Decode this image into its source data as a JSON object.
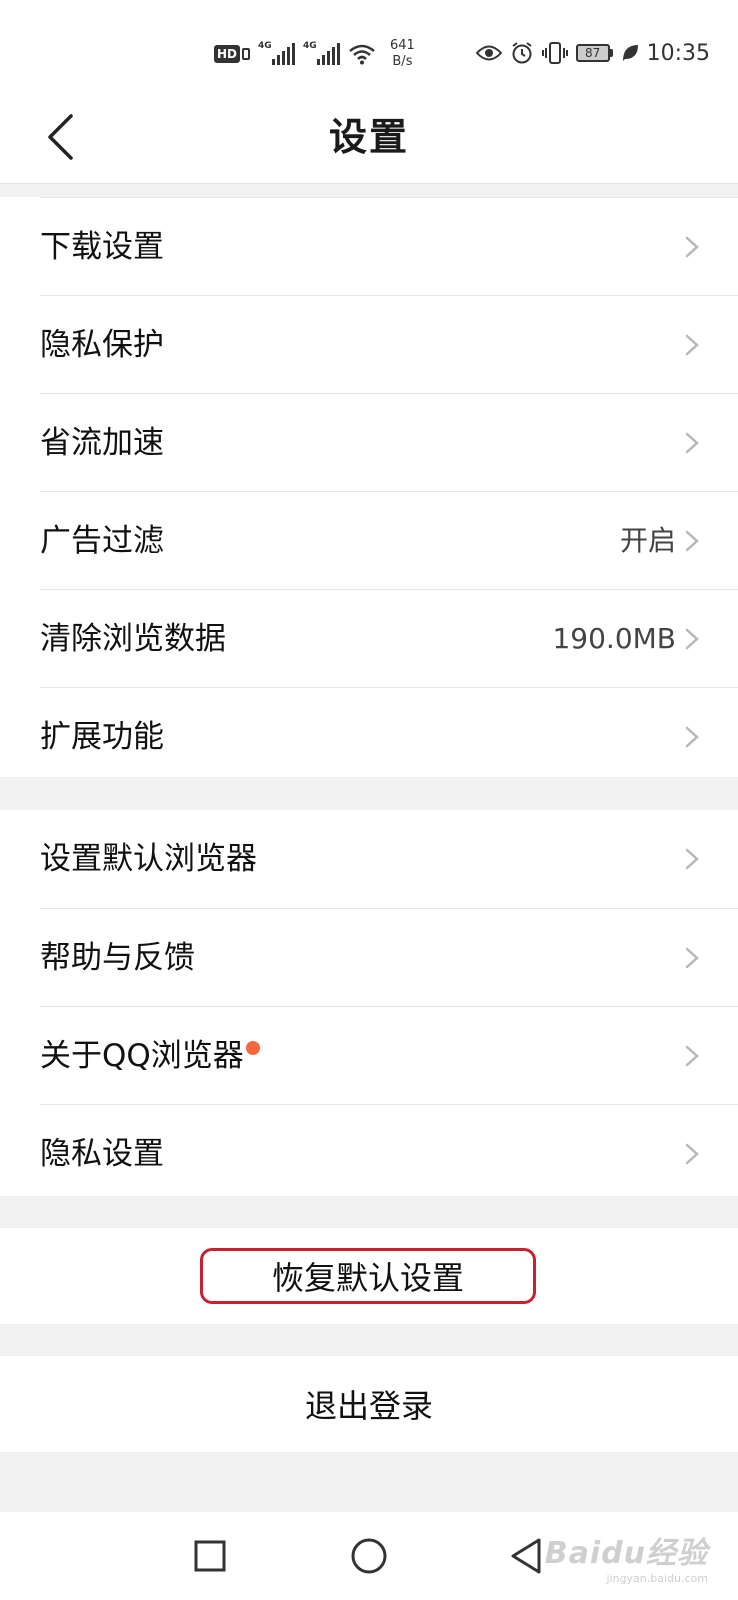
{
  "status_bar": {
    "hd_label": "HD",
    "network_1": "4G",
    "network_2": "4G",
    "speed_value": "641",
    "speed_unit": "B/s",
    "battery": "87",
    "time": "10:35"
  },
  "header": {
    "title": "设置"
  },
  "group1": {
    "items": [
      {
        "label": "下载设置"
      },
      {
        "label": "隐私保护"
      },
      {
        "label": "省流加速"
      },
      {
        "label": "广告过滤",
        "value": "开启"
      },
      {
        "label": "清除浏览数据",
        "value": "190.0MB"
      },
      {
        "label": "扩展功能"
      }
    ]
  },
  "group2": {
    "items": [
      {
        "label": "设置默认浏览器"
      },
      {
        "label": "帮助与反馈"
      },
      {
        "label": "关于QQ浏览器"
      },
      {
        "label": "隐私设置"
      }
    ]
  },
  "actions": {
    "restore_label": "恢复默认设置",
    "logout_label": "退出登录"
  },
  "watermark": {
    "main": "Baidu经验",
    "sub": "jingyan.baidu.com"
  },
  "colors": {
    "accent_red": "#c8202f",
    "badge_dot": "#f5683d"
  }
}
